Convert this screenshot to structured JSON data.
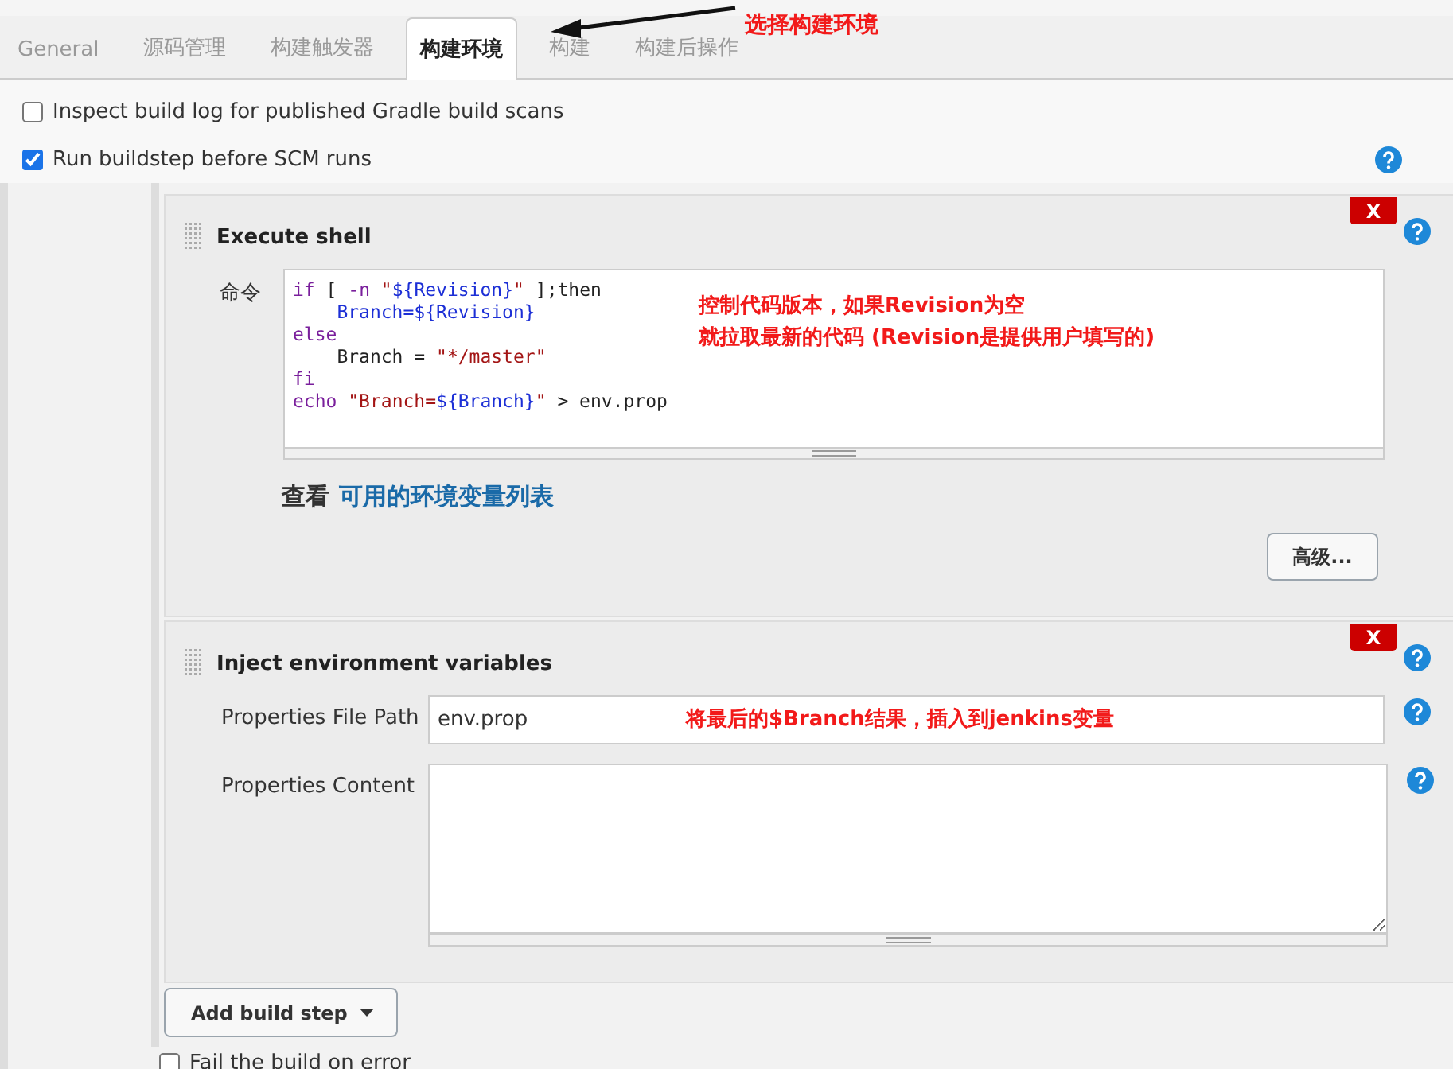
{
  "tabs": [
    {
      "label": "General",
      "selected": false
    },
    {
      "label": "源码管理",
      "selected": false
    },
    {
      "label": "构建触发器",
      "selected": false
    },
    {
      "label": "构建环境",
      "selected": true
    },
    {
      "label": "构建",
      "selected": false
    },
    {
      "label": "构建后操作",
      "selected": false
    }
  ],
  "tab_annotation": "选择构建环境",
  "options": [
    {
      "label": "Inspect build log for published Gradle build scans",
      "checked": false,
      "help": false
    },
    {
      "label": "Run buildstep before SCM runs",
      "checked": true,
      "help": true
    }
  ],
  "execute_shell": {
    "title": "Execute shell",
    "delete": "X",
    "command_label": "命令",
    "code": [
      [
        {
          "t": "if",
          "kind": "keyword"
        },
        {
          "t": " [ ",
          "kind": "plain"
        },
        {
          "t": "-n",
          "kind": "keyword"
        },
        {
          "t": " \"",
          "kind": "string"
        },
        {
          "t": "${Revision}",
          "kind": "variable"
        },
        {
          "t": "\"",
          "kind": "string"
        },
        {
          "t": " ];then",
          "kind": "plain"
        }
      ],
      [
        {
          "t": "    Branch=${Revision}",
          "kind": "variable"
        }
      ],
      [
        {
          "t": "else",
          "kind": "keyword"
        }
      ],
      [
        {
          "t": "    Branch = ",
          "kind": "plain"
        },
        {
          "t": "\"*/master\"",
          "kind": "string"
        }
      ],
      [
        {
          "t": "fi",
          "kind": "keyword"
        }
      ],
      [
        {
          "t": "echo",
          "kind": "keyword"
        },
        {
          "t": " \"Branch=",
          "kind": "string"
        },
        {
          "t": "${Branch}",
          "kind": "variable"
        },
        {
          "t": "\"",
          "kind": "string"
        },
        {
          "t": " > env.prop",
          "kind": "plain"
        }
      ]
    ],
    "code_annotation": [
      "控制代码版本，如果Revision为空",
      "就拉取最新的代码 (Revision是提供用户填写的)"
    ],
    "env_prefix": "查看",
    "env_link": "可用的环境变量列表",
    "advanced_button": "高级..."
  },
  "inject_env": {
    "title": "Inject environment variables",
    "delete": "X",
    "file_path_label": "Properties File Path",
    "file_path_value": "env.prop",
    "file_path_annotation": "将最后的$Branch结果，插入到jenkins变量",
    "content_label": "Properties Content"
  },
  "add_build_step": "Add build step",
  "fail_on_error": {
    "label": "Fail the build on error",
    "checked": false
  }
}
